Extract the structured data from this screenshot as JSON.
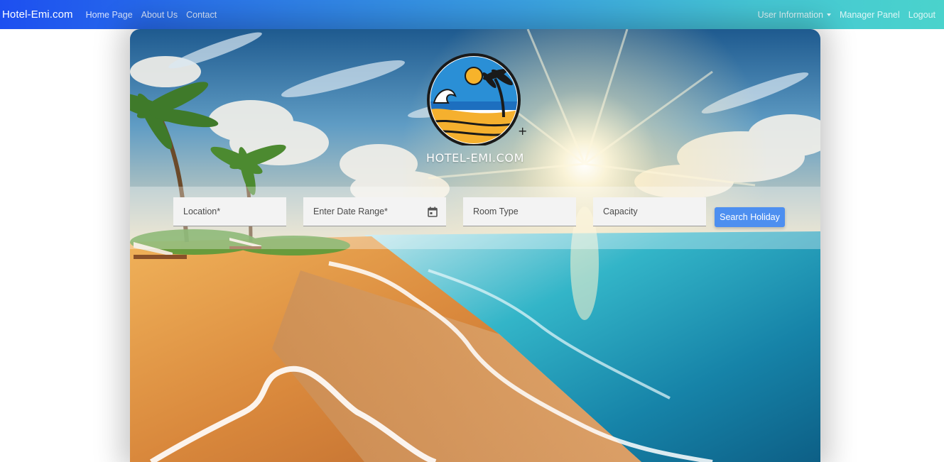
{
  "navbar": {
    "brand": "Hotel-Emi.com",
    "links": [
      "Home Page",
      "About Us",
      "Contact"
    ],
    "user_menu": "User Information",
    "manager_panel": "Manager Panel",
    "logout": "Logout"
  },
  "hero": {
    "logo_text": "HOTEL-EMI.COM"
  },
  "search": {
    "location_placeholder": "Location*",
    "date_placeholder": "Enter Date Range*",
    "room_type_placeholder": "Room Type",
    "capacity_placeholder": "Capacity",
    "button_label": "Search Holiday"
  },
  "icons": {
    "calendar": "calendar-icon",
    "dropdown": "chevron-down-icon"
  },
  "colors": {
    "nav_start": "#1d4ff0",
    "nav_end": "#4ad3cc",
    "button": "#4d8ff0",
    "field_bg": "#f3f3f3"
  }
}
